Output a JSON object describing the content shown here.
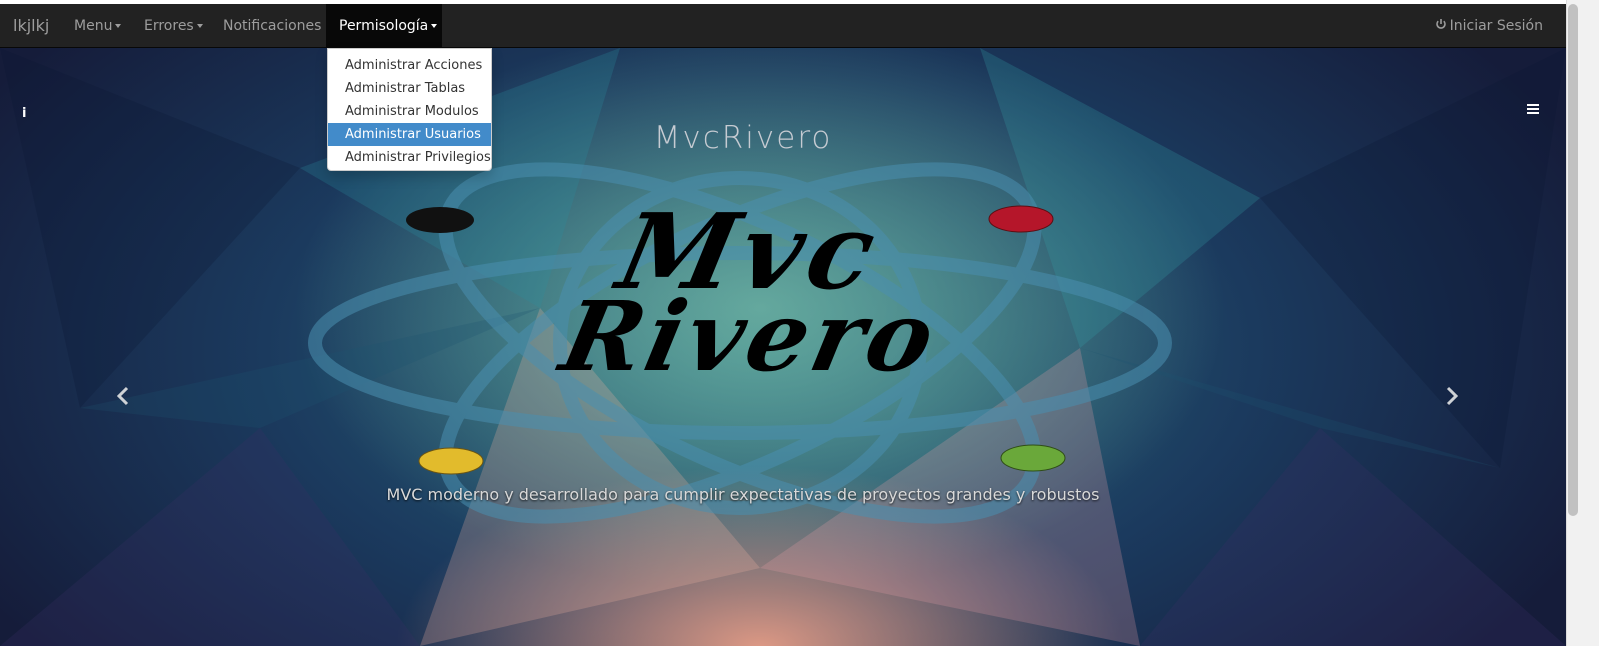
{
  "navbar": {
    "brand": "lkjlkj",
    "items": [
      {
        "label": "Menu",
        "dropdown": true
      },
      {
        "label": "Errores",
        "dropdown": true
      },
      {
        "label": "Notificaciones",
        "dropdown": false
      },
      {
        "label": "Permisología",
        "dropdown": true,
        "active": true
      }
    ],
    "login_label": "Iniciar Sesión",
    "login_icon": "power-icon"
  },
  "dropdown": {
    "items": [
      {
        "label": "Administrar Acciones"
      },
      {
        "label": "Administrar Tablas"
      },
      {
        "label": "Administrar Modulos"
      },
      {
        "label": "Administrar Usuarios",
        "highlighted": true
      },
      {
        "label": "Administrar Privilegios"
      }
    ],
    "highlight_color": "#428bca"
  },
  "hero": {
    "title": "MvcRivero",
    "logo_line1": "Mvc",
    "logo_line2": "Rivero",
    "caption": "MVC moderno y desarrollado para cumplir expectativas de proyectos grandes y robustos",
    "prev_icon": "chevron-left-icon",
    "next_icon": "chevron-right-icon",
    "info_icon": "info-icon",
    "menu_icon": "bars-icon",
    "logo_dot_colors": [
      "#111111",
      "#b5162a",
      "#e2bb2c",
      "#6aa83a"
    ]
  },
  "colors": {
    "navbar_bg": "#222222",
    "navbar_text": "#9d9d9d"
  }
}
